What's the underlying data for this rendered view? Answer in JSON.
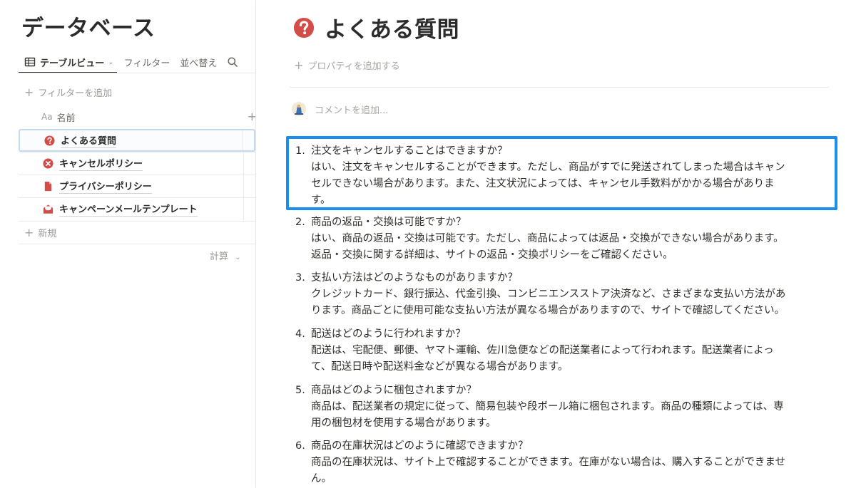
{
  "database": {
    "title": "データベース",
    "toolbar": {
      "view_label": "テーブルビュー",
      "filter_label": "フィルター",
      "sort_label": "並べ替え"
    },
    "add_filter_label": "フィルターを追加",
    "column_header": {
      "type_label": "Aa",
      "name_label": "名前"
    },
    "rows": [
      {
        "label": "よくある質問",
        "icon": "question-circle-icon",
        "color": "#d44c47"
      },
      {
        "label": "キャンセルポリシー",
        "icon": "x-circle-icon",
        "color": "#d44c47"
      },
      {
        "label": "プライバシーポリシー",
        "icon": "document-icon",
        "color": "#d44c47"
      },
      {
        "label": "キャンペーンメールテンプレート",
        "icon": "mail-open-icon",
        "color": "#d44c47"
      }
    ],
    "new_label": "新規",
    "calc_label": "計算"
  },
  "page": {
    "title": "よくある質問",
    "title_icon": "question-circle-icon",
    "add_property_label": "プロパティを追加する",
    "comment_placeholder": "コメントを追加...",
    "faq": [
      {
        "num": "1.",
        "question": "注文をキャンセルすることはできますか？",
        "answer_lines": [
          "はい、注文をキャンセルすることができます。ただし、商品がすでに発送されてしまった場合はキャン",
          "セルできない場合があります。また、注文状況によっては、キャンセル手数料がかかる場合がありま",
          "す。"
        ]
      },
      {
        "num": "2.",
        "question": "商品の返品・交換は可能ですか？",
        "answer_lines": [
          "はい、商品の返品・交換は可能です。ただし、商品によっては返品・交換ができない場合があります。",
          "返品・交換に関する詳細は、サイトの返品・交換ポリシーをご確認ください。"
        ]
      },
      {
        "num": "3.",
        "question": "支払い方法はどのようなものがありますか？",
        "answer_lines": [
          "クレジットカード、銀行振込、代金引換、コンビニエンスストア決済など、さまざまな支払い方法があ",
          "ります。商品ごとに使用可能な支払い方法が異なる場合がありますので、サイトで確認してください。"
        ]
      },
      {
        "num": "4.",
        "question": "配送はどのように行われますか？",
        "answer_lines": [
          "配送は、宅配便、郵便、ヤマト運輸、佐川急便などの配送業者によって行われます。配送業者によっ",
          "て、配送日時や配送料金などが異なる場合があります。"
        ]
      },
      {
        "num": "5.",
        "question": "商品はどのように梱包されますか？",
        "answer_lines": [
          "商品は、配送業者の規定に従って、簡易包装や段ボール箱に梱包されます。商品の種類によっては、専",
          "用の梱包材を使用する場合があります。"
        ]
      },
      {
        "num": "6.",
        "question": "商品の在庫状況はどのように確認できますか？",
        "answer_lines": [
          "商品の在庫状況は、サイト上で確認することができます。在庫がない場合は、購入することができませ",
          "ん。"
        ]
      }
    ]
  },
  "colors": {
    "highlight": "#1a8ef0",
    "icon_red": "#d44c47"
  }
}
